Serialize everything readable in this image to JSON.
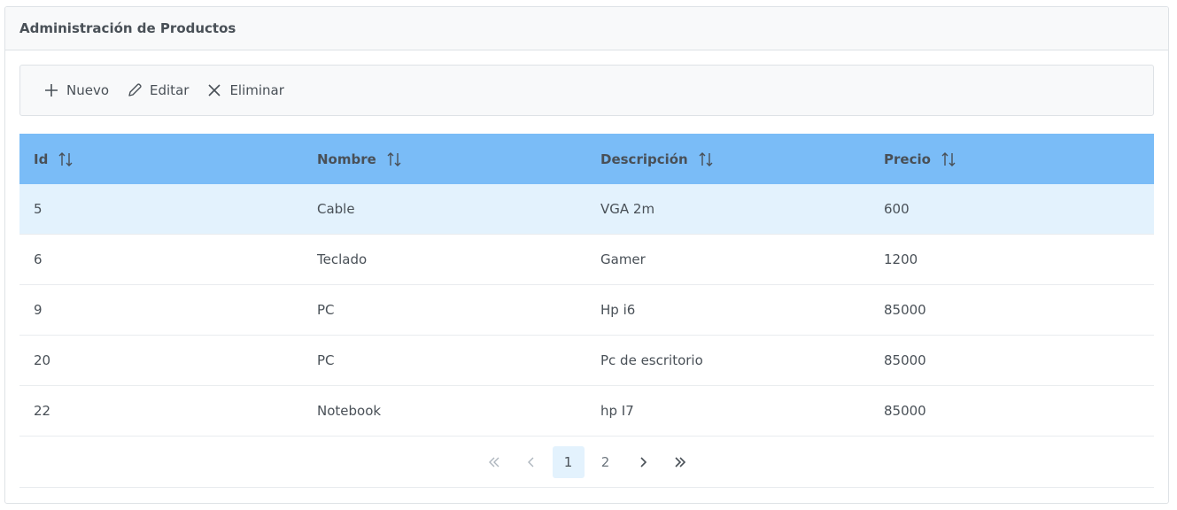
{
  "panel": {
    "title": "Administración de Productos"
  },
  "toolbar": {
    "new_label": "Nuevo",
    "edit_label": "Editar",
    "delete_label": "Eliminar"
  },
  "table": {
    "columns": [
      "Id",
      "Nombre",
      "Descripción",
      "Precio"
    ],
    "rows": [
      [
        "5",
        "Cable",
        "VGA 2m",
        "600"
      ],
      [
        "6",
        "Teclado",
        "Gamer",
        "1200"
      ],
      [
        "9",
        "PC",
        "Hp i6",
        "85000"
      ],
      [
        "20",
        "PC",
        "Pc de escritorio",
        "85000"
      ],
      [
        "22",
        "Notebook",
        "hp I7",
        "85000"
      ]
    ],
    "selected_row_index": 0
  },
  "paginator": {
    "pages": [
      "1",
      "2"
    ],
    "current_page": "1"
  },
  "colors": {
    "header_bg": "#7abcf7",
    "selected_row_bg": "#e3f2fd"
  }
}
